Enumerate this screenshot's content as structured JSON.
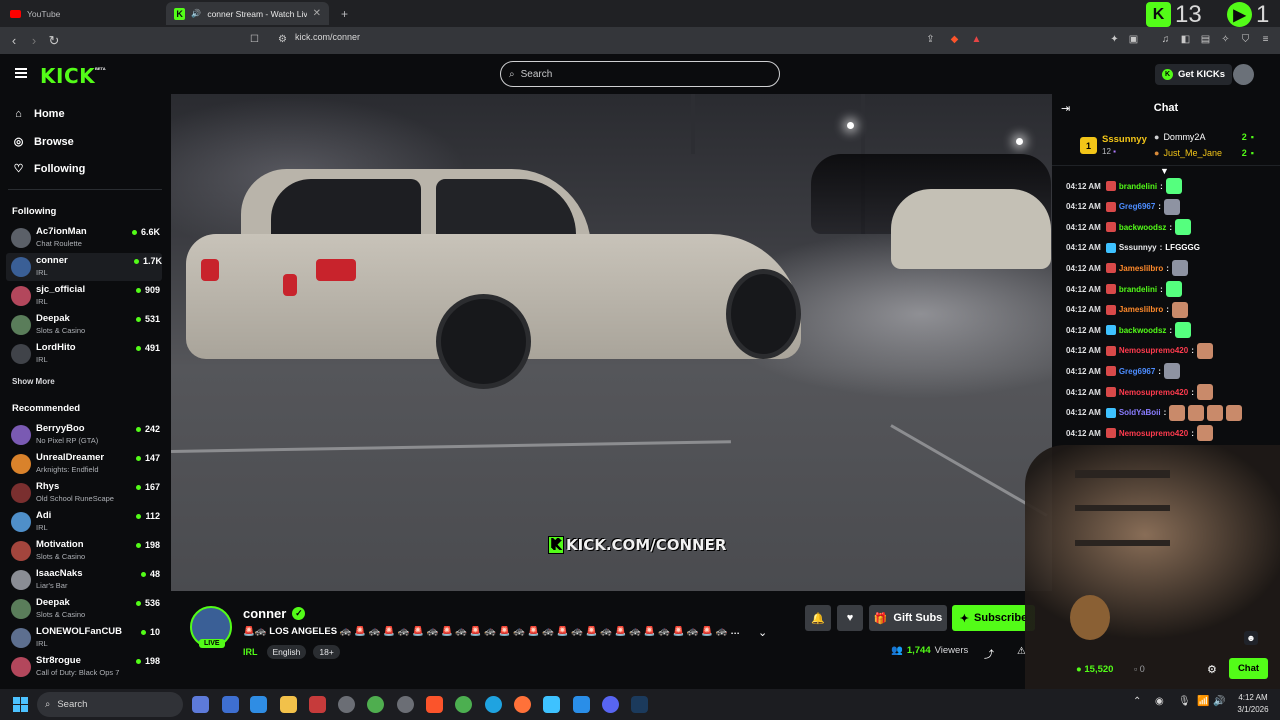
{
  "browser": {
    "tabs": [
      {
        "title": "YouTube",
        "icon": "youtube-icon"
      },
      {
        "title": "conner Stream - Watch Live on Kick",
        "icon": "kick-icon",
        "active": true
      }
    ],
    "new_tab": "+",
    "url": "kick.com/conner",
    "counters": {
      "a": "13",
      "b": "1"
    }
  },
  "topnav": {
    "logo": "KICK",
    "beta": "BETA",
    "search_placeholder": "Search",
    "get_kicks": "Get KICKs"
  },
  "sidebar": {
    "nav": [
      {
        "label": "Home",
        "icon": "home-icon"
      },
      {
        "label": "Browse",
        "icon": "compass-icon"
      },
      {
        "label": "Following",
        "icon": "heart-icon"
      }
    ],
    "following_title": "Following",
    "following": [
      {
        "name": "Ac7ionMan",
        "category": "Chat Roulette",
        "viewers": "6.6K"
      },
      {
        "name": "conner",
        "category": "IRL",
        "viewers": "1.7K",
        "active": true
      },
      {
        "name": "sjc_official",
        "category": "IRL",
        "viewers": "909"
      },
      {
        "name": "Deepak",
        "category": "Slots & Casino",
        "viewers": "531"
      },
      {
        "name": "LordHito",
        "category": "IRL",
        "viewers": "491"
      }
    ],
    "show_more": "Show More",
    "recommended_title": "Recommended",
    "recommended": [
      {
        "name": "BerryyBoo",
        "category": "No Pixel RP (GTA)",
        "viewers": "242"
      },
      {
        "name": "UnrealDreamer",
        "category": "Arknights: Endfield",
        "viewers": "147"
      },
      {
        "name": "Rhys",
        "category": "Old School RuneScape",
        "viewers": "167"
      },
      {
        "name": "Adi",
        "category": "IRL",
        "viewers": "112"
      },
      {
        "name": "Motivation",
        "category": "Slots & Casino",
        "viewers": "198"
      },
      {
        "name": "IsaacNaks",
        "category": "Liar's Bar",
        "viewers": "48"
      },
      {
        "name": "Deepak",
        "category": "Slots & Casino",
        "viewers": "536"
      },
      {
        "name": "LONEWOLFanCUB",
        "category": "IRL",
        "viewers": "10"
      },
      {
        "name": "Str8rogue",
        "category": "Call of Duty: Black Ops 7",
        "viewers": "198"
      }
    ]
  },
  "video": {
    "watermark": "KICK.COM/CONNER"
  },
  "stream": {
    "name": "conner",
    "live": "LIVE",
    "title": "🚨🚓 LOS ANGELES 🚓 🚨 🚓 🚨 🚓 🚨 🚓 🚨 🚓 🚨 🚓 🚨 🚓 🚨 🚓 🚨 🚓 🚨 🚓 🚨 🚓 🚨 🚓 🚨 🚓 🚨 🚓 🚨 🚓 🚨 🚓 🚨 🚓 🚨 🚓 🚨 🚓 ...",
    "category": "IRL",
    "tags": [
      "English",
      "18+"
    ],
    "gift_subs": "Gift Subs",
    "subscribe": "Subscribe",
    "viewers": "1,744",
    "viewers_label": "Viewers"
  },
  "chat": {
    "title": "Chat",
    "leaderboard": {
      "first": {
        "rank": "1",
        "name": "Sssunnyy",
        "count": "12"
      },
      "others": [
        {
          "name": "Dommy2A",
          "count": "2"
        },
        {
          "name": "Just_Me_Jane",
          "count": "2"
        }
      ]
    },
    "messages": [
      {
        "time": "04:12 AM",
        "user": "brandelini",
        "color": "#53fc18",
        "text": "",
        "emote": "w"
      },
      {
        "time": "04:12 AM",
        "user": "Greg6967",
        "color": "#4d8dff",
        "text": "",
        "emote": "plain"
      },
      {
        "time": "04:12 AM",
        "user": "backwoodsz",
        "color": "#53fc18",
        "text": "",
        "emote": "w"
      },
      {
        "time": "04:12 AM",
        "user": "Sssunnyy",
        "color": "#e9eaec",
        "text": "LFGGGG",
        "emote": ""
      },
      {
        "time": "04:12 AM",
        "user": "Jameslilbro",
        "color": "#ff8a2b",
        "text": "",
        "emote": "plain"
      },
      {
        "time": "04:12 AM",
        "user": "brandelini",
        "color": "#53fc18",
        "text": "",
        "emote": "w"
      },
      {
        "time": "04:12 AM",
        "user": "Jameslilbro",
        "color": "#ff8a2b",
        "text": "",
        "emote": "face"
      },
      {
        "time": "04:12 AM",
        "user": "backwoodsz",
        "color": "#53fc18",
        "text": "",
        "emote": "w"
      },
      {
        "time": "04:12 AM",
        "user": "Nemosupremo420",
        "color": "#ff3b4e",
        "text": "",
        "emote": "face"
      },
      {
        "time": "04:12 AM",
        "user": "Greg6967",
        "color": "#4d8dff",
        "text": "",
        "emote": "plain"
      },
      {
        "time": "04:12 AM",
        "user": "Nemosupremo420",
        "color": "#ff3b4e",
        "text": "",
        "emote": "face"
      },
      {
        "time": "04:12 AM",
        "user": "SoldYaBoii",
        "color": "#8a7dff",
        "text": "",
        "emote": "faces"
      },
      {
        "time": "04:12 AM",
        "user": "Nemosupremo420",
        "color": "#ff3b4e",
        "text": "",
        "emote": "face"
      }
    ],
    "kicks_balance": "15,520",
    "other_balance": "0",
    "send": "Chat"
  },
  "taskbar": {
    "search": "Search",
    "time": "4:12 AM",
    "date": "3/1/2026"
  }
}
